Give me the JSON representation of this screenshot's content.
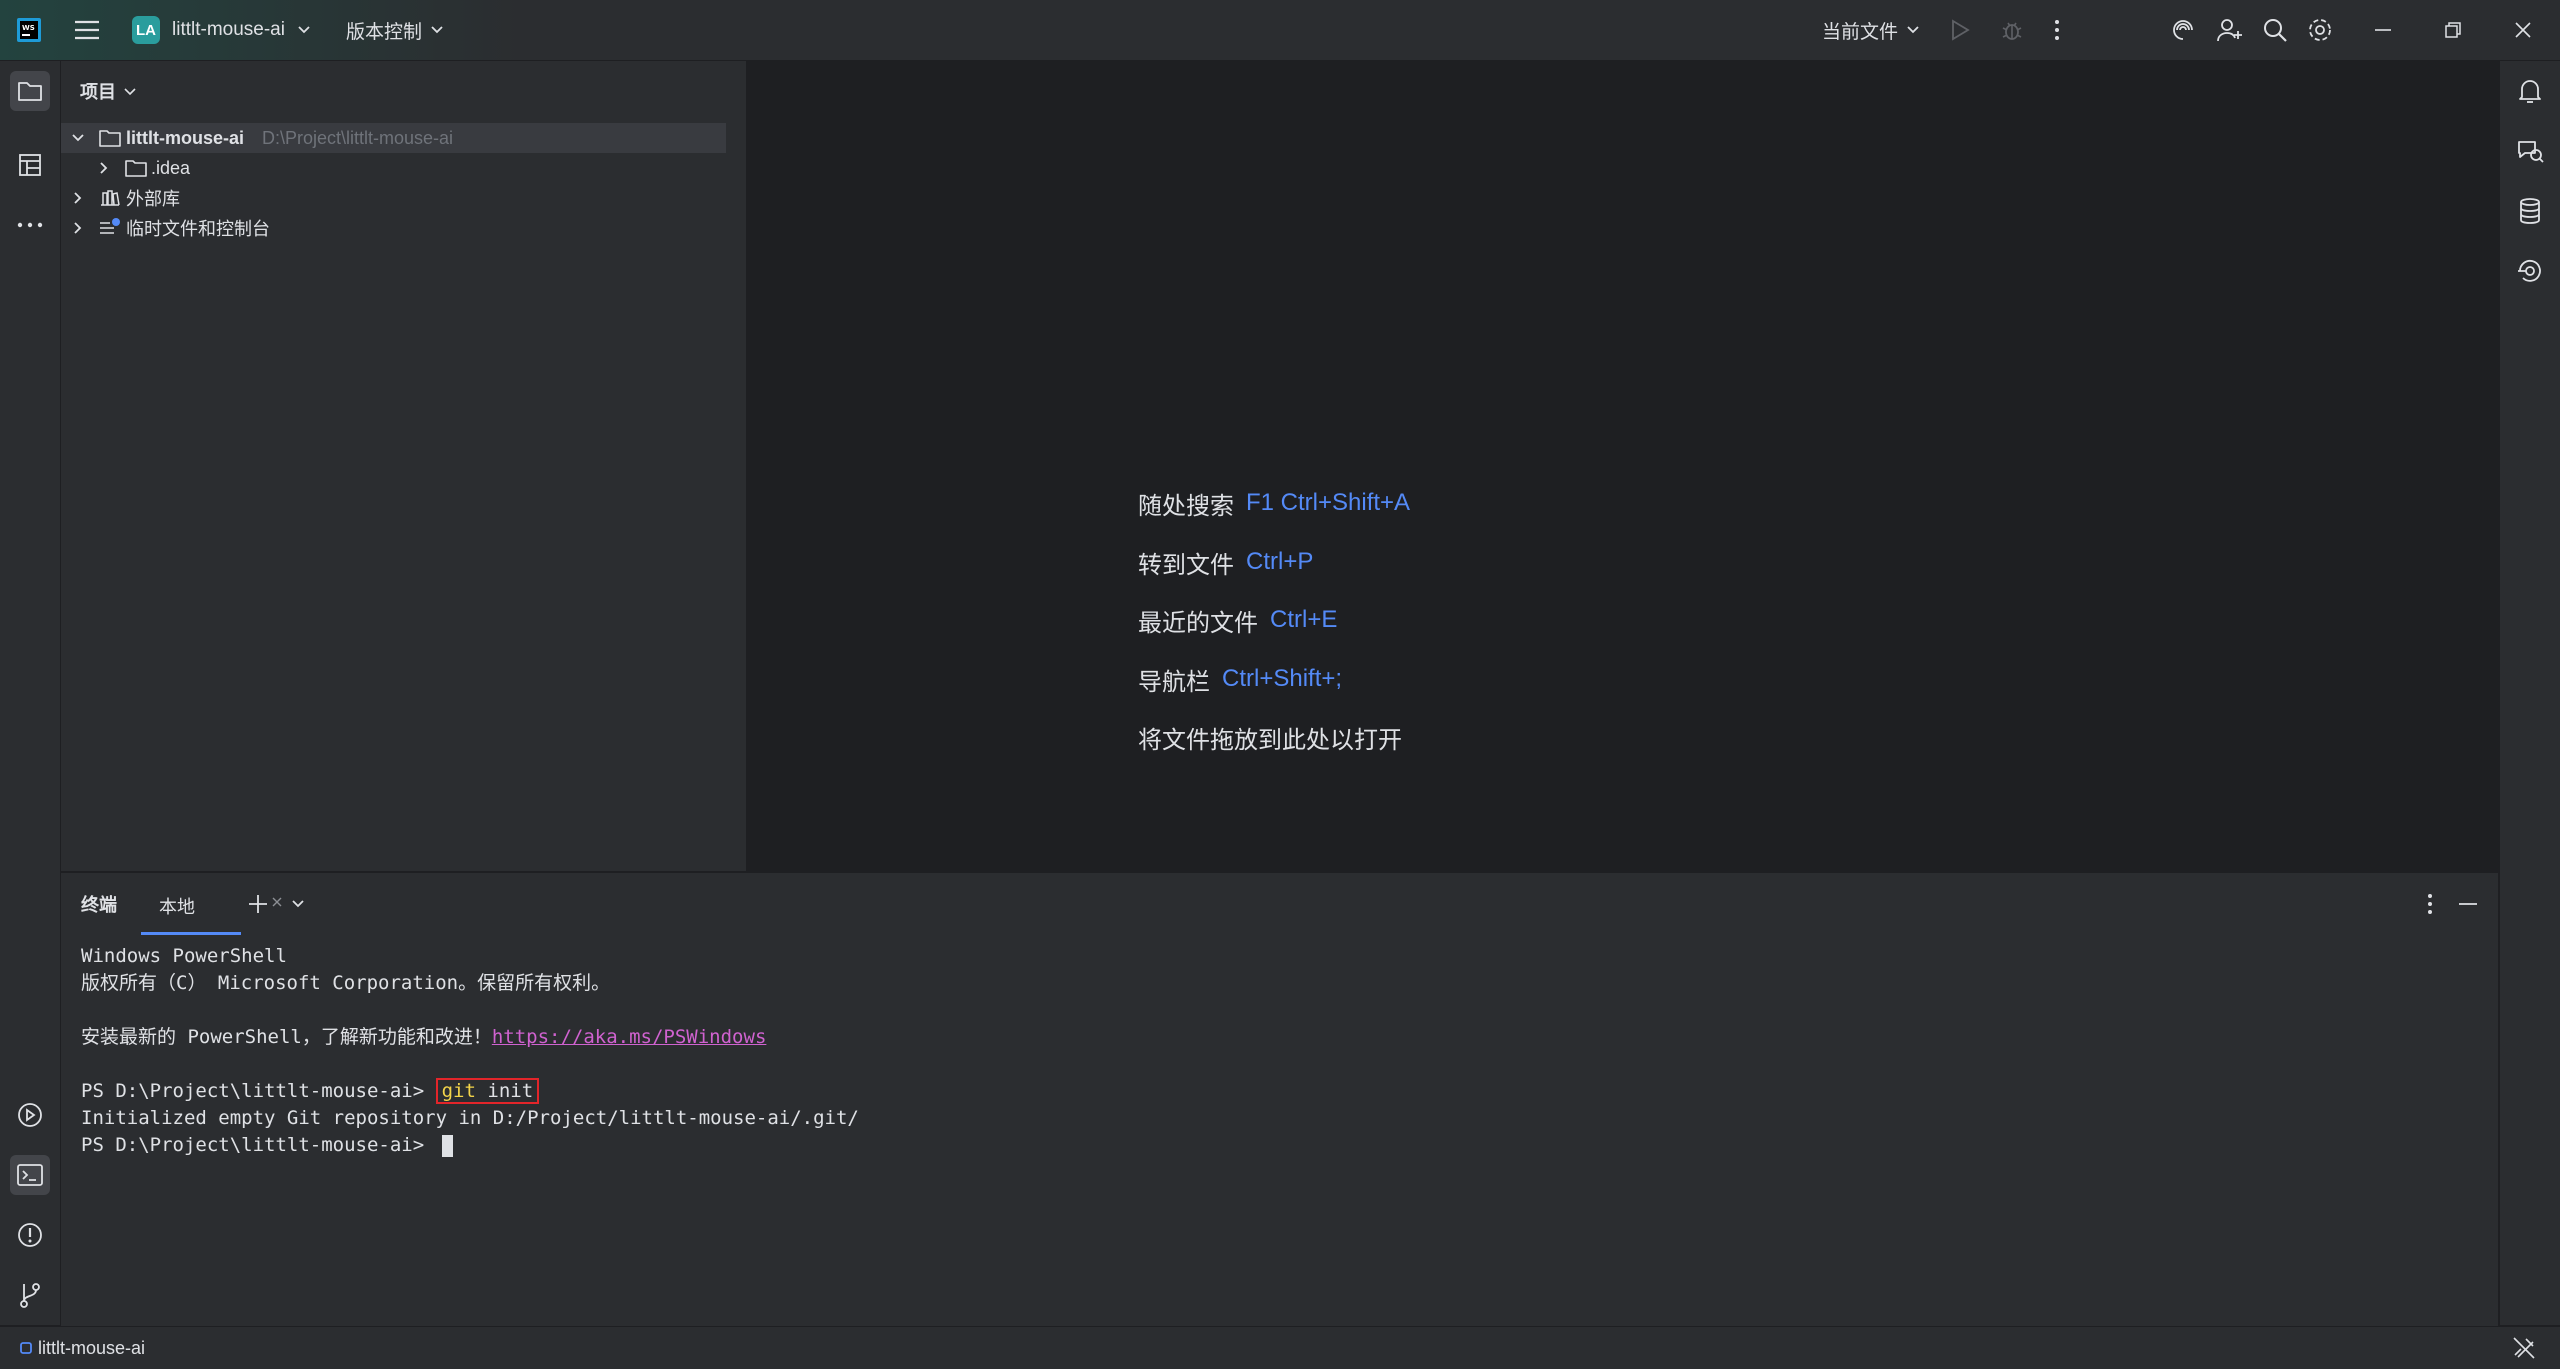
{
  "titlebar": {
    "project_badge": "LA",
    "project_name": "littlt-mouse-ai",
    "vcs_label": "版本控制",
    "run_config": "当前文件",
    "icons": [
      "app-logo-icon",
      "hamburger-menu-icon",
      "chevron-down-icon",
      "run-icon",
      "debug-icon",
      "more-vertical-icon",
      "ai-assistant-icon",
      "add-user-icon",
      "search-icon",
      "settings-icon",
      "minimize-icon",
      "restore-icon",
      "close-icon"
    ]
  },
  "left_strip": {
    "icons": [
      "project-folder-icon",
      "structure-icon",
      "more-horizontal-icon",
      "services-icon",
      "terminal-icon",
      "problems-icon",
      "git-branch-icon"
    ]
  },
  "right_strip": {
    "icons": [
      "notifications-icon",
      "ai-chat-icon",
      "database-icon",
      "endpoints-icon"
    ]
  },
  "project_panel": {
    "title": "项目",
    "tree": [
      {
        "name": "littlt-mouse-ai",
        "path": "D:\\Project\\littlt-mouse-ai",
        "expanded": true
      },
      {
        "name": ".idea"
      },
      {
        "name": "外部库"
      },
      {
        "name": "临时文件和控制台"
      }
    ]
  },
  "editor": {
    "hints": [
      {
        "label": "随处搜索",
        "shortcut": "F1 Ctrl+Shift+A"
      },
      {
        "label": "转到文件",
        "shortcut": "Ctrl+P"
      },
      {
        "label": "最近的文件",
        "shortcut": "Ctrl+E"
      },
      {
        "label": "导航栏",
        "shortcut": "Ctrl+Shift+;"
      },
      {
        "label": "将文件拖放到此处以打开",
        "shortcut": ""
      }
    ]
  },
  "terminal": {
    "title": "终端",
    "tab": "本地",
    "lines": {
      "l1": "Windows PowerShell",
      "l2": "版权所有（C） Microsoft Corporation。保留所有权利。",
      "l3_text": "安装最新的 PowerShell，了解新功能和改进！",
      "l3_link": "https://aka.ms/PSWindows",
      "prompt": "PS D:\\Project\\littlt-mouse-ai> ",
      "cmd_git": "git",
      "cmd_rest": " init",
      "l5": "Initialized empty Git repository in D:/Project/littlt-mouse-ai/.git/",
      "prompt2": "PS D:\\Project\\littlt-mouse-ai> "
    }
  },
  "statusbar": {
    "project": "littlt-mouse-ai"
  },
  "colors": {
    "accent": "#548af7",
    "link": "#d062d0",
    "highlight_border": "#e3252a",
    "command": "#f3d44a"
  }
}
